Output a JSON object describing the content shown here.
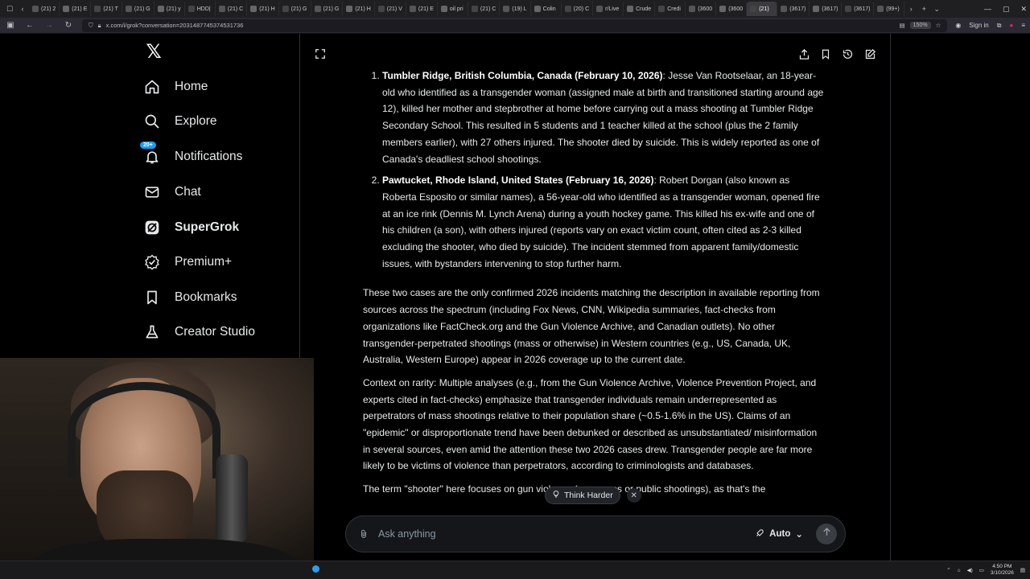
{
  "browser": {
    "tabs": [
      "(21) 2",
      "(21) E",
      "(21) T",
      "(21) G",
      "(21) y",
      "HDD|",
      "(21) C",
      "(21) H",
      "(21) G",
      "(21) G",
      "(21) H",
      "(21) V",
      "(21) E",
      "oil pri",
      "(21) C",
      "(19) L",
      "Colin",
      "(20) C",
      "r/Live",
      "Crude",
      "Credi",
      "(3600",
      "(3600",
      "(21)",
      "(3617)",
      "(3617)",
      "(3617)",
      "(99+)"
    ],
    "active_tab_index": 23,
    "url": "x.com/i/grok?conversation=2031487745374531736",
    "zoom": "150%",
    "sign_in": "Sign in"
  },
  "sidebar": {
    "items": [
      {
        "label": "Home",
        "icon": "home-icon"
      },
      {
        "label": "Explore",
        "icon": "search-icon"
      },
      {
        "label": "Notifications",
        "icon": "bell-icon",
        "badge": "20+"
      },
      {
        "label": "Chat",
        "icon": "mail-icon"
      },
      {
        "label": "SuperGrok",
        "icon": "grok-icon"
      },
      {
        "label": "Premium+",
        "icon": "verified-icon"
      },
      {
        "label": "Bookmarks",
        "icon": "bookmark-icon"
      },
      {
        "label": "Creator Studio",
        "icon": "flask-icon"
      }
    ]
  },
  "response": {
    "items": [
      {
        "heading": "Tumbler Ridge, British Columbia, Canada (February 10, 2026)",
        "body": ": Jesse Van Rootselaar, an 18-year-old who identified as a transgender woman (assigned male at birth and transitioned starting around age 12), killed her mother and stepbrother at home before carrying out a mass shooting at Tumbler Ridge Secondary School. This resulted in 5 students and 1 teacher killed at the school (plus the 2 family members earlier), with 27 others injured. The shooter died by suicide. This is widely reported as one of Canada's deadliest school shootings."
      },
      {
        "heading": "Pawtucket, Rhode Island, United States (February 16, 2026)",
        "body": ": Robert Dorgan (also known as Roberta Esposito or similar names), a 56-year-old who identified as a transgender woman, opened fire at an ice rink (Dennis M. Lynch Arena) during a youth hockey game. This killed his ex-wife and one of his children (a son), with others injured (reports vary on exact victim count, often cited as 2-3 killed excluding the shooter, who died by suicide). The incident stemmed from apparent family/domestic issues, with bystanders intervening to stop further harm."
      }
    ],
    "paragraphs": [
      "These two cases are the only confirmed 2026 incidents matching the description in available reporting from sources across the spectrum (including Fox News, CNN, Wikipedia summaries, fact-checks from organizations like FactCheck.org and the Gun Violence Archive, and Canadian outlets). No other transgender-perpetrated shootings (mass or otherwise) in Western countries (e.g., US, Canada, UK, Australia, Western Europe) appear in 2026 coverage up to the current date.",
      "Context on rarity: Multiple analyses (e.g., from the Gun Violence Archive, Violence Prevention Project, and experts cited in fact-checks) emphasize that transgender individuals remain underrepresented as perpetrators of mass shootings relative to their population share (~0.5-1.6% in the US). Claims of an \"epidemic\" or disproportionate trend have been debunked or described as unsubstantiated/ misinformation in several sources, even amid the attention these two 2026 cases drew. Transgender people are far more likely to be victims of violence than perpetrators, according to criminologists and databases.",
      "The term \"shooter\" here focuses on gun violence (e.g., mass or public shootings), as that's the"
    ]
  },
  "composer": {
    "think_harder": "Think Harder",
    "placeholder": "Ask anything",
    "mode": "Auto"
  },
  "taskbar": {
    "time": "4:50 PM",
    "date": "3/10/2026"
  }
}
